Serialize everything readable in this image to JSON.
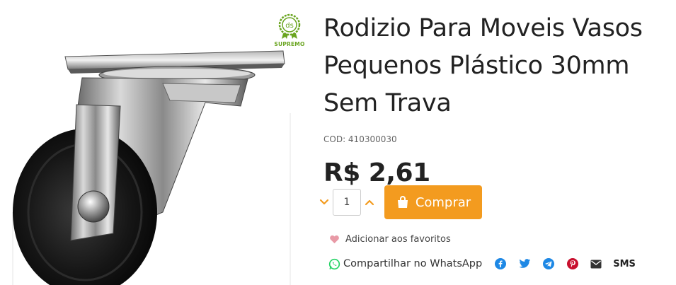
{
  "product": {
    "title_lines": [
      "Rodizio Para Moveis Vasos",
      "Pequenos Plástico 30mm",
      "Sem Trava"
    ],
    "code": "COD: 410300030",
    "price": "R$ 2,61",
    "image_alt": "Rodízio giratório com roda preta"
  },
  "brand_badge": {
    "monogram": "ds",
    "label": "SUPREMO",
    "color": "#6aa520"
  },
  "purchase": {
    "quantity": "1",
    "buy_label": "Comprar",
    "accent_color": "#f39b1f",
    "decrease_icon": "chevron-down-icon",
    "increase_icon": "chevron-up-icon",
    "cart_icon": "shopping-bag-icon"
  },
  "favorites": {
    "label": "Adicionar aos favoritos",
    "icon": "heart-icon"
  },
  "share": {
    "whatsapp_label": "Compartilhar no WhatsApp",
    "networks": [
      "facebook-icon",
      "twitter-icon",
      "telegram-icon",
      "pinterest-icon",
      "email-icon"
    ],
    "sms_label": "SMS",
    "share_color": "#1e88e5"
  }
}
